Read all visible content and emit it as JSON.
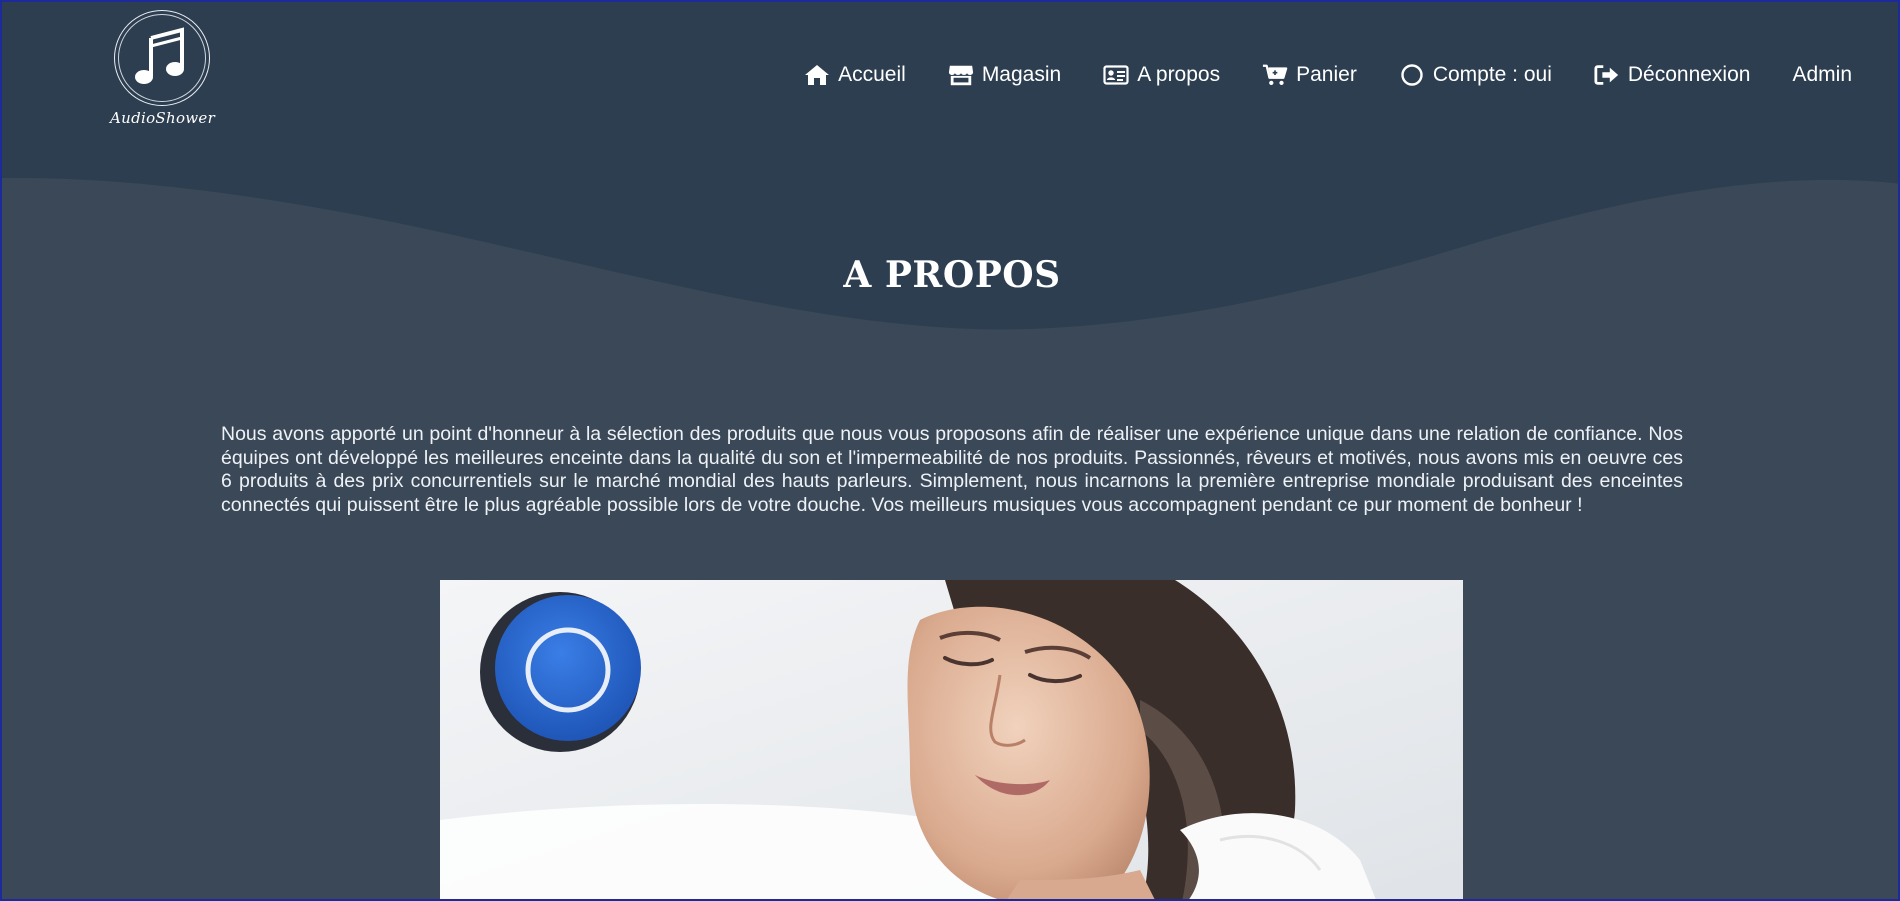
{
  "brand": {
    "name": "AudioShower",
    "logo_icon": "music-note-icon"
  },
  "nav": {
    "items": [
      {
        "label": "Accueil",
        "icon": "home-icon"
      },
      {
        "label": "Magasin",
        "icon": "store-icon"
      },
      {
        "label": "A propos",
        "icon": "id-card-icon"
      },
      {
        "label": "Panier",
        "icon": "cart-icon"
      },
      {
        "label": "Compte : oui",
        "icon": "circle-icon"
      },
      {
        "label": "Déconnexion",
        "icon": "sign-out-icon"
      },
      {
        "label": "Admin",
        "icon": ""
      }
    ]
  },
  "page": {
    "title": "A PROPOS",
    "body": "Nous avons apporté un point d'honneur à la sélection des produits que nous vous proposons afin de réaliser une expérience unique dans une relation de confiance. Nos équipes ont développé les meilleures enceinte dans la qualité du son et l'impermeabilité de nos produits. Passionnés, rêveurs et motivés, nous avons mis en oeuvre ces 6 produits à des prix concurrentiels sur le marché mondial des hauts parleurs. Simplement, nous incarnons la première entreprise mondiale produisant des enceintes connectés qui puissent être le plus agréable possible lors de votre douche. Vos meilleurs musiques vous accompagnent pendant ce pur moment de bonheur !"
  },
  "colors": {
    "header_bg": "#2c3e50",
    "page_bg": "#3a4858",
    "text": "#ffffff",
    "speaker_blue": "#2f6fd8"
  }
}
